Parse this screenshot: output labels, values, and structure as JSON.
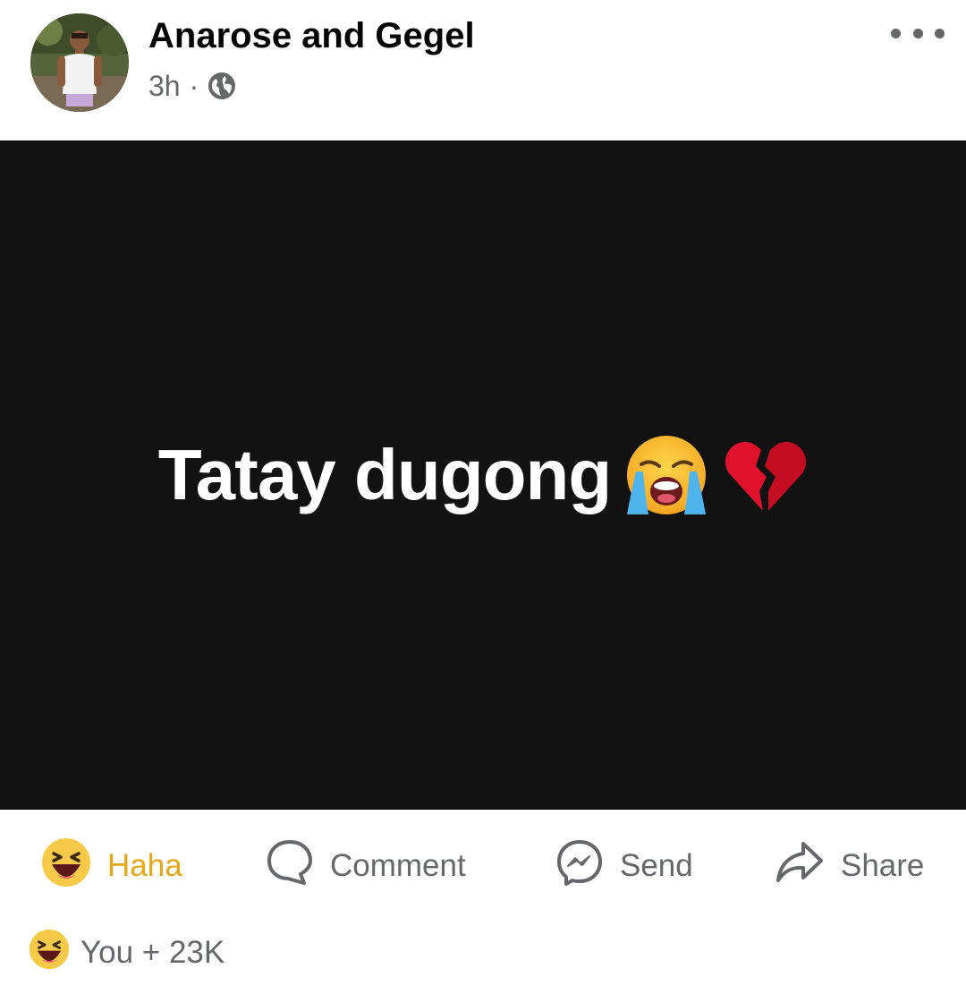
{
  "header": {
    "author_name": "Anarose and Gegel",
    "time_ago": "3h",
    "separator": "·",
    "privacy_icon": "globe-icon",
    "more_icon": "more-horizontal-icon"
  },
  "post": {
    "text": "Tatay dugong",
    "emojis": [
      "loudly-crying-face-emoji",
      "broken-heart-emoji"
    ],
    "background_color": "#121212",
    "text_color": "#ffffff"
  },
  "actions": {
    "haha_label": "Haha",
    "comment_label": "Comment",
    "send_label": "Send",
    "share_label": "Share",
    "active_reaction_color": "#e6a619",
    "icon_color": "#65676b"
  },
  "reactions_summary": {
    "text": "You + 23K",
    "icon": "haha-reaction-icon"
  }
}
